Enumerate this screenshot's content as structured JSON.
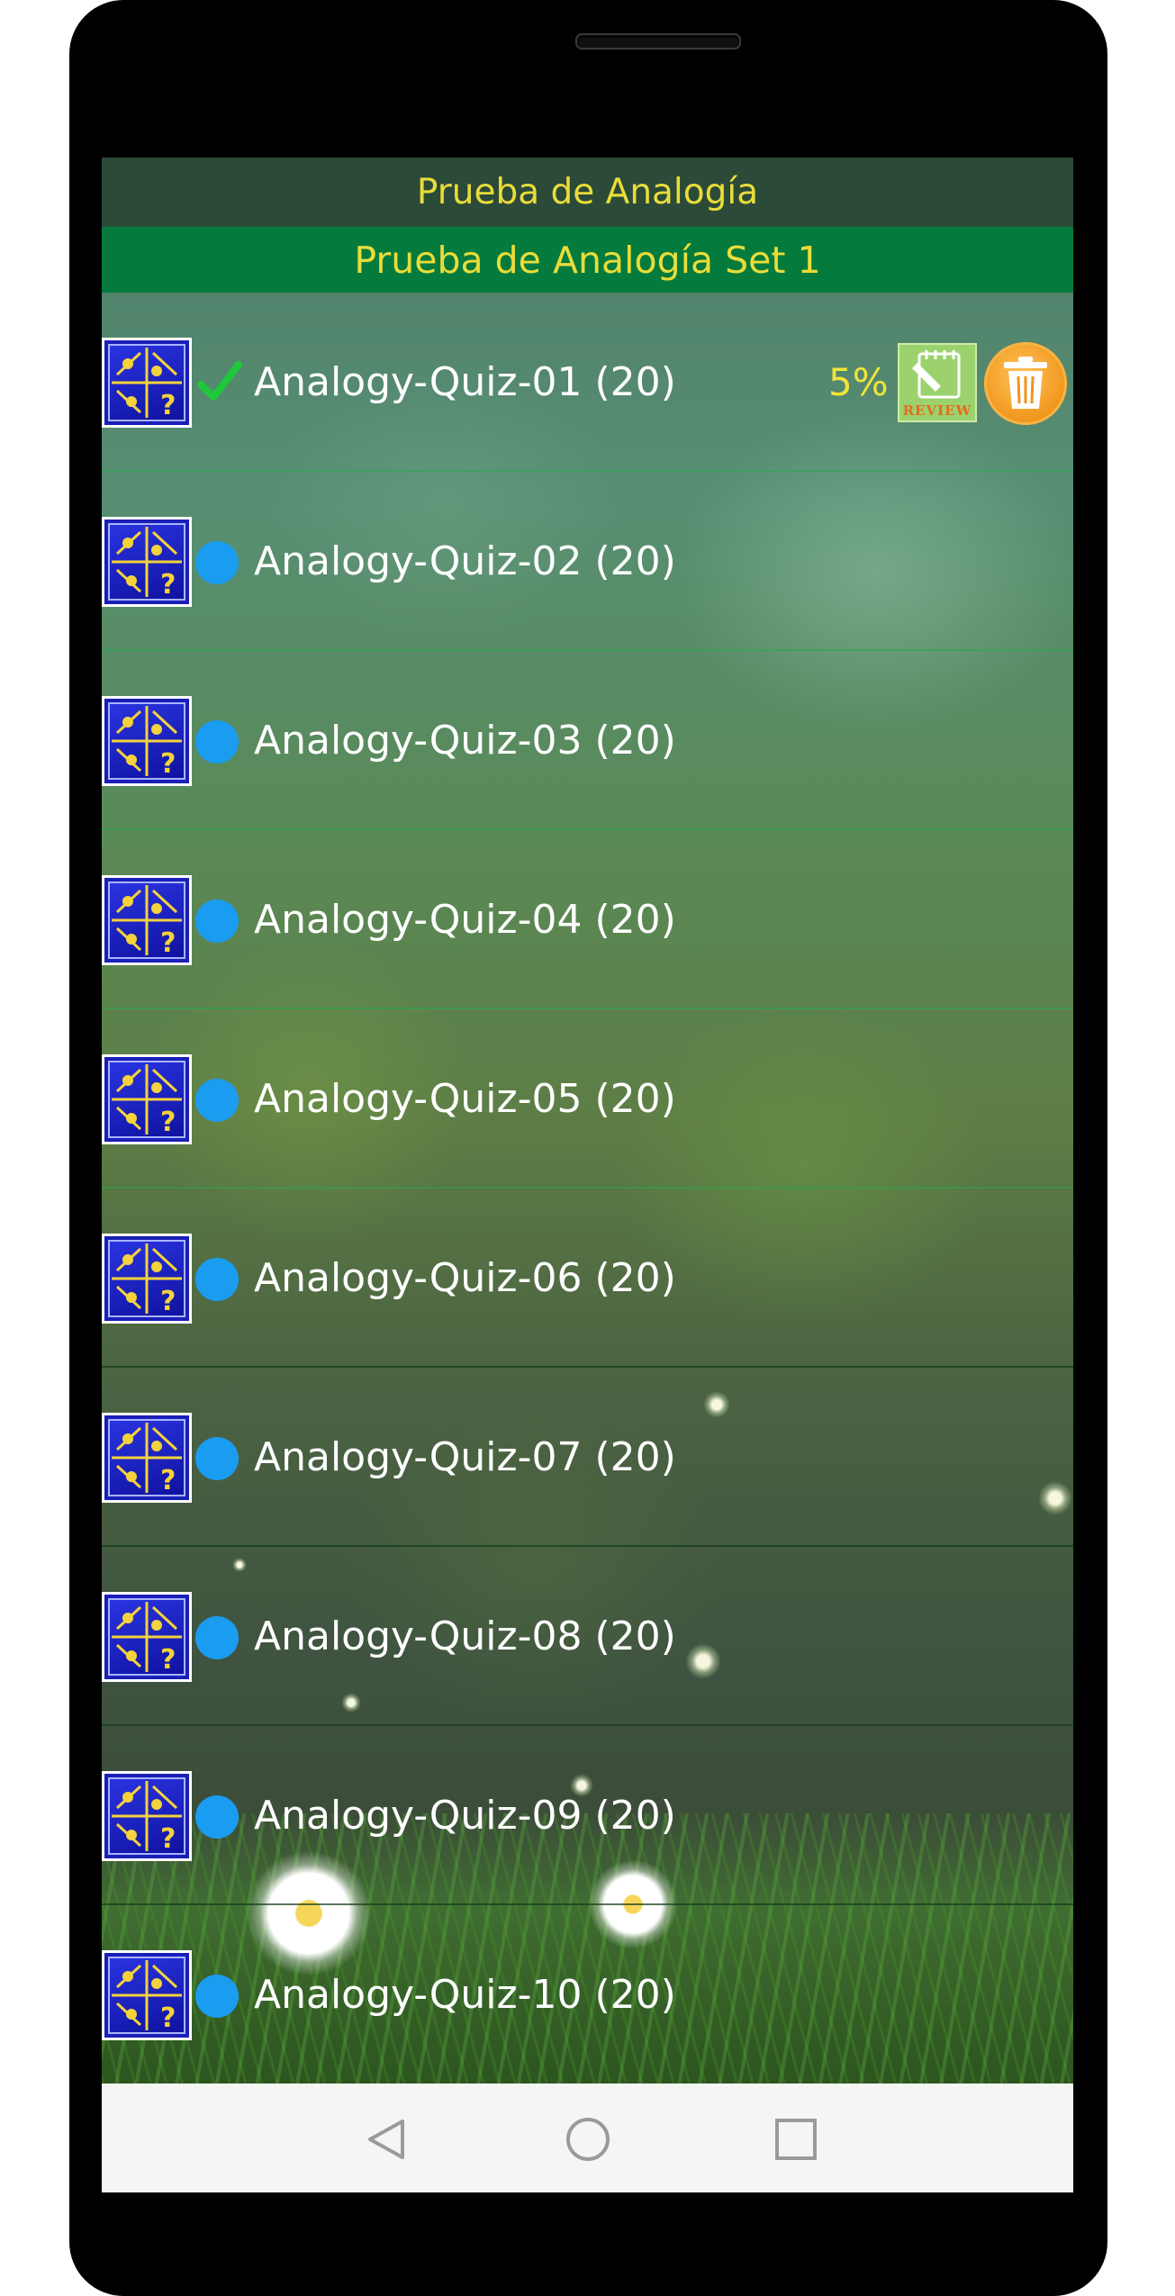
{
  "header": {
    "title": "Prueba de Analogía",
    "subtitle": "Prueba de Analogía Set 1"
  },
  "quizzes": [
    {
      "label": "Analogy-Quiz-01 (20)",
      "status": "completed",
      "progress": "5%",
      "review_label": "REVIEW"
    },
    {
      "label": "Analogy-Quiz-02 (20)",
      "status": "not-started"
    },
    {
      "label": "Analogy-Quiz-03 (20)",
      "status": "not-started"
    },
    {
      "label": "Analogy-Quiz-04 (20)",
      "status": "not-started"
    },
    {
      "label": "Analogy-Quiz-05 (20)",
      "status": "not-started"
    },
    {
      "label": "Analogy-Quiz-06 (20)",
      "status": "not-started"
    },
    {
      "label": "Analogy-Quiz-07 (20)",
      "status": "not-started"
    },
    {
      "label": "Analogy-Quiz-08 (20)",
      "status": "not-started"
    },
    {
      "label": "Analogy-Quiz-09 (20)",
      "status": "not-started"
    },
    {
      "label": "Analogy-Quiz-10 (20)",
      "status": "not-started"
    }
  ],
  "icons": {
    "quiz": "quiz-analogy-icon",
    "completed": "check-icon",
    "not_started": "blue-dot-icon",
    "review": "review-icon",
    "delete": "trash-icon"
  },
  "navigation": {
    "back": "back-icon",
    "home": "home-icon",
    "recent": "recent-apps-icon"
  },
  "colors": {
    "title_text": "#e9dc3a",
    "title_bar": "#2c4a38",
    "subtitle_bar": "#047b3c",
    "dot": "#1a9cf0",
    "check": "#1ec83a",
    "progress_text": "#f0e43a"
  }
}
